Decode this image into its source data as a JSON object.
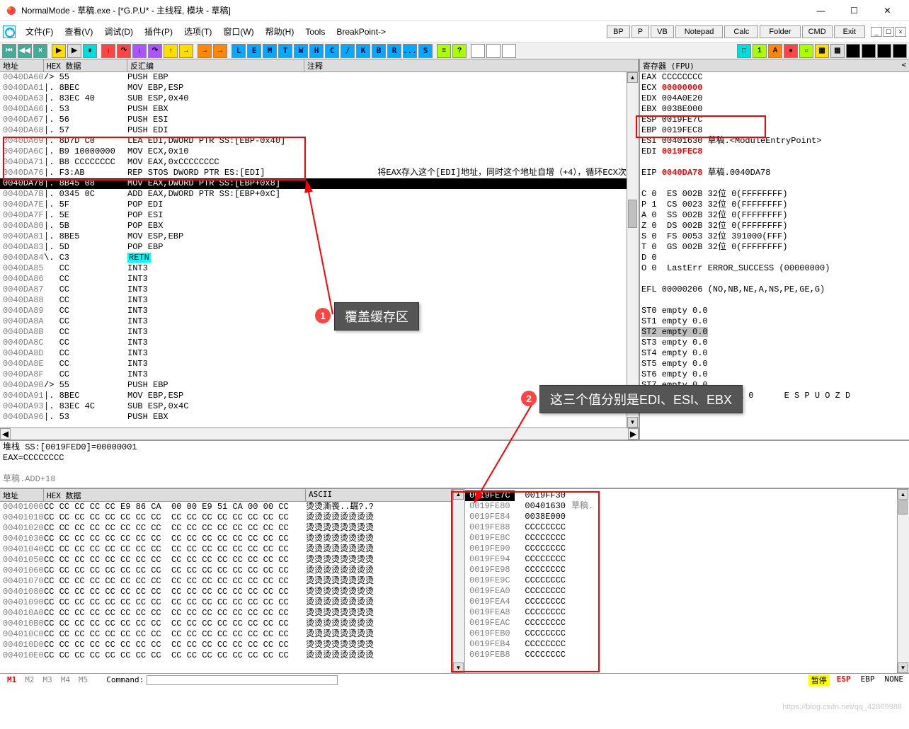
{
  "window": {
    "title": "NormalMode - 草稿.exe - [*G.P.U* - 主线程, 模块 - 草稿]",
    "min": "—",
    "max": "☐",
    "close": "✕"
  },
  "menu": {
    "items": [
      "文件(F)",
      "查看(V)",
      "调试(D)",
      "插件(P)",
      "选项(T)",
      "窗口(W)",
      "帮助(H)",
      "Tools",
      "BreakPoint->"
    ],
    "right": [
      "BP",
      "P",
      "VB",
      "Notepad",
      "Calc",
      "Folder",
      "CMD",
      "Exit"
    ]
  },
  "toolbar_letters": [
    "L",
    "E",
    "M",
    "T",
    "W",
    "H",
    "C",
    "/",
    "K",
    "B",
    "R",
    "...",
    "S"
  ],
  "cpu": {
    "hdr_addr": "地址",
    "hdr_hex": "HEX 数据",
    "hdr_dis": "反汇编",
    "hdr_cmt": "注释",
    "rows": [
      {
        "a": "0040DA60",
        "h": "/> 55",
        "d": "PUSH EBP"
      },
      {
        "a": "0040DA61",
        "h": "|. 8BEC",
        "d": "MOV EBP,ESP"
      },
      {
        "a": "0040DA63",
        "h": "|. 83EC 40",
        "d": "SUB ESP,0x40"
      },
      {
        "a": "0040DA66",
        "h": "|. 53",
        "d": "PUSH EBX"
      },
      {
        "a": "0040DA67",
        "h": "|. 56",
        "d": "PUSH ESI"
      },
      {
        "a": "0040DA68",
        "h": "|. 57",
        "d": "PUSH EDI"
      },
      {
        "a": "0040DA69",
        "h": "|. 8D7D C0",
        "d": "LEA EDI,DWORD PTR SS:[EBP-0x40]",
        "box": true
      },
      {
        "a": "0040DA6C",
        "h": "|. B9 10000000",
        "d": "MOV ECX,0x10",
        "box": true
      },
      {
        "a": "0040DA71",
        "h": "|. B8 CCCCCCCC",
        "d": "MOV EAX,0xCCCCCCCC",
        "box": true
      },
      {
        "a": "0040DA76",
        "h": "|. F3:AB",
        "d": "REP STOS DWORD PTR ES:[EDI]",
        "box": true,
        "c": "将EAX存入这个[EDI]地址，同时这个地址自增（+4），循环ECX次"
      },
      {
        "a": "0040DA78",
        "h": "|. 8B45 08",
        "d": "MOV EAX,DWORD PTR SS:[EBP+0x8]",
        "hl": true
      },
      {
        "a": "0040DA7B",
        "h": "|. 0345 0C",
        "d": "ADD EAX,DWORD PTR SS:[EBP+0xC]"
      },
      {
        "a": "0040DA7E",
        "h": "|. 5F",
        "d": "POP EDI"
      },
      {
        "a": "0040DA7F",
        "h": "|. 5E",
        "d": "POP ESI"
      },
      {
        "a": "0040DA80",
        "h": "|. 5B",
        "d": "POP EBX"
      },
      {
        "a": "0040DA81",
        "h": "|. 8BE5",
        "d": "MOV ESP,EBP"
      },
      {
        "a": "0040DA83",
        "h": "|. 5D",
        "d": "POP EBP"
      },
      {
        "a": "0040DA84",
        "h": "\\. C3",
        "d": "RETN",
        "retn": true
      },
      {
        "a": "0040DA85",
        "h": "   CC",
        "d": "INT3"
      },
      {
        "a": "0040DA86",
        "h": "   CC",
        "d": "INT3"
      },
      {
        "a": "0040DA87",
        "h": "   CC",
        "d": "INT3"
      },
      {
        "a": "0040DA88",
        "h": "   CC",
        "d": "INT3"
      },
      {
        "a": "0040DA89",
        "h": "   CC",
        "d": "INT3"
      },
      {
        "a": "0040DA8A",
        "h": "   CC",
        "d": "INT3"
      },
      {
        "a": "0040DA8B",
        "h": "   CC",
        "d": "INT3"
      },
      {
        "a": "0040DA8C",
        "h": "   CC",
        "d": "INT3"
      },
      {
        "a": "0040DA8D",
        "h": "   CC",
        "d": "INT3"
      },
      {
        "a": "0040DA8E",
        "h": "   CC",
        "d": "INT3"
      },
      {
        "a": "0040DA8F",
        "h": "   CC",
        "d": "INT3"
      },
      {
        "a": "0040DA90",
        "h": "/> 55",
        "d": "PUSH EBP"
      },
      {
        "a": "0040DA91",
        "h": "|. 8BEC",
        "d": "MOV EBP,ESP"
      },
      {
        "a": "0040DA93",
        "h": "|. 83EC 4C",
        "d": "SUB ESP,0x4C"
      },
      {
        "a": "0040DA96",
        "h": "|. 53",
        "d": "PUSH EBX"
      }
    ]
  },
  "reg": {
    "hdr": "寄存器 (FPU)",
    "lines": [
      "EAX CCCCCCCC",
      "ECX |00000000",
      "EDX 004A0E20",
      "EBX 0038E000",
      "ESP 0019FE7C",
      "EBP 0019FEC8",
      "ESI 00401630 草稿.<ModuleEntryPoint>",
      "EDI |0019FEC8",
      "",
      "EIP |0040DA78 |草稿.0040DA78",
      "",
      "C 0  ES 002B 32位 0(FFFFFFFF)",
      "P 1  CS 0023 32位 0(FFFFFFFF)",
      "A 0  SS 002B 32位 0(FFFFFFFF)",
      "Z 0  DS 002B 32位 0(FFFFFFFF)",
      "S 0  FS 0053 32位 391000(FFF)",
      "T 0  GS 002B 32位 0(FFFFFFFF)",
      "D 0",
      "O 0  LastErr ERROR_SUCCESS (00000000)",
      "",
      "EFL 00000206 (NO,NB,NE,A,NS,PE,GE,G)",
      "",
      "ST0 empty 0.0",
      "ST1 empty 0.0",
      "ST2 empty 0.0",
      "ST3 empty 0.0",
      "ST4 empty 0.0",
      "ST5 empty 0.0",
      "ST6 empty 0.0",
      "ST7 empty 0.0",
      "               3 2 1 0      E S P U O Z D"
    ]
  },
  "info": {
    "l1": "堆栈 SS:[0019FED0]=00000001",
    "l2": "EAX=CCCCCCCC",
    "l3": "草稿.ADD+18"
  },
  "dump": {
    "hdr_addr": "地址",
    "hdr_hex": "HEX 数据",
    "hdr_ascii": "ASCII",
    "rows": [
      {
        "a": "00401000",
        "h": "CC CC CC CC CC E9 86 CA  00 00 E9 51 CA 00 00 CC",
        "s": "烫烫澌喪..镼?.?"
      },
      {
        "a": "00401010",
        "h": "CC CC CC CC CC CC CC CC  CC CC CC CC CC CC CC CC",
        "s": "烫烫烫烫烫烫烫烫"
      },
      {
        "a": "00401020",
        "h": "CC CC CC CC CC CC CC CC  CC CC CC CC CC CC CC CC",
        "s": "烫烫烫烫烫烫烫烫"
      },
      {
        "a": "00401030",
        "h": "CC CC CC CC CC CC CC CC  CC CC CC CC CC CC CC CC",
        "s": "烫烫烫烫烫烫烫烫"
      },
      {
        "a": "00401040",
        "h": "CC CC CC CC CC CC CC CC  CC CC CC CC CC CC CC CC",
        "s": "烫烫烫烫烫烫烫烫"
      },
      {
        "a": "00401050",
        "h": "CC CC CC CC CC CC CC CC  CC CC CC CC CC CC CC CC",
        "s": "烫烫烫烫烫烫烫烫"
      },
      {
        "a": "00401060",
        "h": "CC CC CC CC CC CC CC CC  CC CC CC CC CC CC CC CC",
        "s": "烫烫烫烫烫烫烫烫"
      },
      {
        "a": "00401070",
        "h": "CC CC CC CC CC CC CC CC  CC CC CC CC CC CC CC CC",
        "s": "烫烫烫烫烫烫烫烫"
      },
      {
        "a": "00401080",
        "h": "CC CC CC CC CC CC CC CC  CC CC CC CC CC CC CC CC",
        "s": "烫烫烫烫烫烫烫烫"
      },
      {
        "a": "00401090",
        "h": "CC CC CC CC CC CC CC CC  CC CC CC CC CC CC CC CC",
        "s": "烫烫烫烫烫烫烫烫"
      },
      {
        "a": "004010A0",
        "h": "CC CC CC CC CC CC CC CC  CC CC CC CC CC CC CC CC",
        "s": "烫烫烫烫烫烫烫烫"
      },
      {
        "a": "004010B0",
        "h": "CC CC CC CC CC CC CC CC  CC CC CC CC CC CC CC CC",
        "s": "烫烫烫烫烫烫烫烫"
      },
      {
        "a": "004010C0",
        "h": "CC CC CC CC CC CC CC CC  CC CC CC CC CC CC CC CC",
        "s": "烫烫烫烫烫烫烫烫"
      },
      {
        "a": "004010D0",
        "h": "CC CC CC CC CC CC CC CC  CC CC CC CC CC CC CC CC",
        "s": "烫烫烫烫烫烫烫烫"
      },
      {
        "a": "004010E0",
        "h": "CC CC CC CC CC CC CC CC  CC CC CC CC CC CC CC CC",
        "s": "烫烫烫烫烫烫烫烫"
      }
    ]
  },
  "stack": {
    "rows": [
      {
        "a": "0019FE7C",
        "v": "0019FF30",
        "hl": true
      },
      {
        "a": "0019FE80",
        "v": "00401630",
        "c": "草稿.<ModuleEntryPoint>"
      },
      {
        "a": "0019FE84",
        "v": "0038E000"
      },
      {
        "a": "0019FE88",
        "v": "CCCCCCCC"
      },
      {
        "a": "0019FE8C",
        "v": "CCCCCCCC"
      },
      {
        "a": "0019FE90",
        "v": "CCCCCCCC"
      },
      {
        "a": "0019FE94",
        "v": "CCCCCCCC"
      },
      {
        "a": "0019FE98",
        "v": "CCCCCCCC"
      },
      {
        "a": "0019FE9C",
        "v": "CCCCCCCC"
      },
      {
        "a": "0019FEA0",
        "v": "CCCCCCCC"
      },
      {
        "a": "0019FEA4",
        "v": "CCCCCCCC"
      },
      {
        "a": "0019FEA8",
        "v": "CCCCCCCC"
      },
      {
        "a": "0019FEAC",
        "v": "CCCCCCCC"
      },
      {
        "a": "0019FEB0",
        "v": "CCCCCCCC"
      },
      {
        "a": "0019FEB4",
        "v": "CCCCCCCC"
      },
      {
        "a": "0019FEB8",
        "v": "CCCCCCCC"
      }
    ]
  },
  "status": {
    "m": [
      "M1",
      "M2",
      "M3",
      "M4",
      "M5"
    ],
    "cmd": "Command:",
    "right": [
      "ESP",
      "EBP",
      "NONE"
    ],
    "pause": "暂停"
  },
  "annot": {
    "a1": "覆盖缓存区",
    "a2": "这三个值分别是EDI、ESI、EBX"
  },
  "watermark": "https://blog.csdn.net/qq_42869986"
}
